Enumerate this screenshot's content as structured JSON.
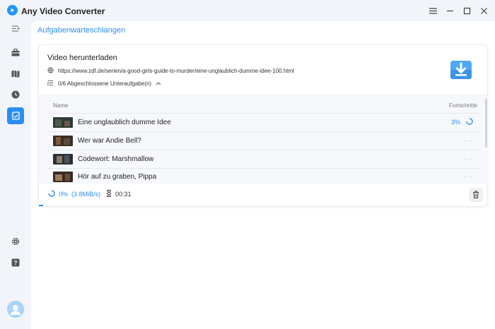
{
  "app": {
    "title": "Any Video Converter"
  },
  "colors": {
    "accent": "#2a8ef0",
    "sidebar_active": "#2a8ef0"
  },
  "sidebar": {
    "items": [
      {
        "icon": "menu-collapse-icon"
      },
      {
        "icon": "toolbox-icon"
      },
      {
        "icon": "map-icon"
      },
      {
        "icon": "history-icon"
      },
      {
        "icon": "task-queue-icon",
        "active": true
      },
      {
        "icon": "gear-icon"
      },
      {
        "icon": "help-icon"
      },
      {
        "icon": "user-avatar-icon"
      }
    ]
  },
  "breadcrumb": "Aufgabenwarteschlangen",
  "task": {
    "title": "Video herunterladen",
    "url": "https://www.zdf.de/serien/a-good-girls-guide-to-murder/eine-unglaublich-dumme-idee-100.html",
    "subtasks_label": "0/6 Abgeschlossene Unteraufgabe(n)",
    "columns": {
      "name": "Name",
      "progress": "Fortschritte"
    },
    "rows": [
      {
        "name": "Eine unglaublich dumme Idee",
        "progress": "3%",
        "status": "downloading"
      },
      {
        "name": "Wer war Andie Bell?",
        "progress": "···",
        "status": "pending"
      },
      {
        "name": "Codewort: Marshmallow",
        "progress": "···",
        "status": "pending"
      },
      {
        "name": "Hör auf zu graben, Pippa",
        "progress": "···",
        "status": "pending"
      }
    ],
    "footer": {
      "percent": "0%",
      "speed": "(3.8MiB/s)",
      "elapsed": "00:31",
      "overall_progress": 0.01
    }
  }
}
